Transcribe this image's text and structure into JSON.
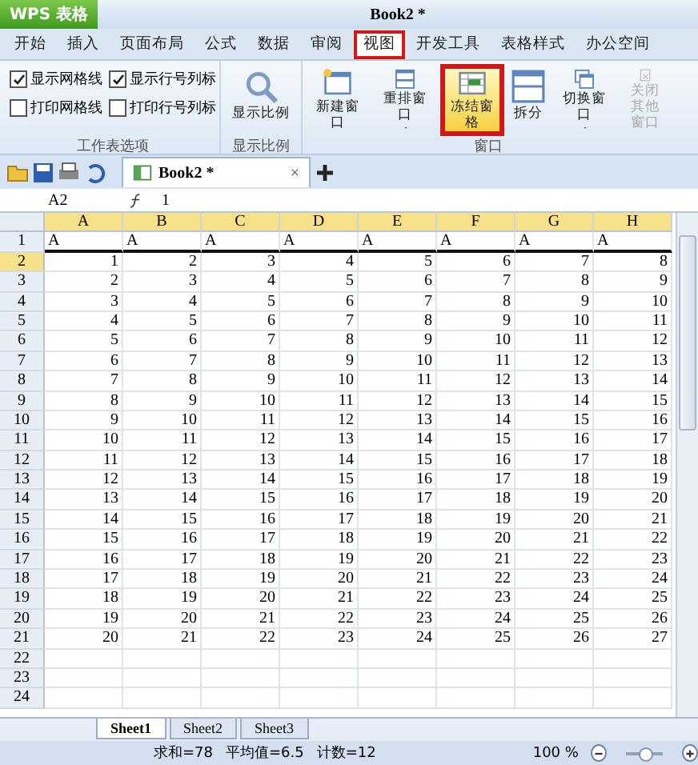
{
  "window": {
    "app_button": "WPS 表格",
    "title": "Book2 *"
  },
  "menu_tabs": [
    {
      "label": "开始",
      "selected": false
    },
    {
      "label": "插入",
      "selected": false
    },
    {
      "label": "页面布局",
      "selected": false
    },
    {
      "label": "公式",
      "selected": false
    },
    {
      "label": "数据",
      "selected": false
    },
    {
      "label": "审阅",
      "selected": false
    },
    {
      "label": "视图",
      "selected": true
    },
    {
      "label": "开发工具",
      "selected": false
    },
    {
      "label": "表格样式",
      "selected": false
    },
    {
      "label": "办公空间",
      "selected": false
    }
  ],
  "ribbon": {
    "sheet_options": {
      "title": "工作表选项",
      "checkboxes": [
        {
          "label": "显示网格线",
          "checked": true
        },
        {
          "label": "显示行号列标",
          "checked": true
        },
        {
          "label": "打印网格线",
          "checked": false
        },
        {
          "label": "打印行号列标",
          "checked": false
        }
      ]
    },
    "zoom_group": {
      "title": "显示比例",
      "button": "显示比例"
    },
    "window_group": {
      "title": "窗口",
      "buttons": [
        {
          "label": "新建窗口",
          "kind": "new",
          "dropdown": false,
          "highlighted": false,
          "disabled": false
        },
        {
          "label": "重排窗口",
          "kind": "arrange",
          "dropdown": true,
          "highlighted": false,
          "disabled": false
        },
        {
          "label": "冻结窗格",
          "kind": "freeze",
          "dropdown": false,
          "highlighted": true,
          "disabled": false
        },
        {
          "label": "拆分",
          "kind": "split",
          "dropdown": false,
          "highlighted": false,
          "disabled": false
        },
        {
          "label": "切换窗口",
          "kind": "switch",
          "dropdown": true,
          "highlighted": false,
          "disabled": false
        },
        {
          "label": "关闭其他窗口",
          "kind": "close",
          "dropdown": false,
          "highlighted": false,
          "disabled": true
        }
      ]
    }
  },
  "doc_tab": {
    "label": "Book2 *",
    "close": "×"
  },
  "formula_bar": {
    "name_box": "A2",
    "value": "1"
  },
  "sheet": {
    "columns": [
      "A",
      "B",
      "C",
      "D",
      "E",
      "F",
      "G",
      "H"
    ],
    "rows": [
      {
        "header": "1",
        "cells": [
          "A",
          "A",
          "A",
          "A",
          "A",
          "A",
          "A",
          "A"
        ]
      },
      {
        "header": "2",
        "cells": [
          "1",
          "2",
          "3",
          "4",
          "5",
          "6",
          "7",
          "8"
        ]
      },
      {
        "header": "3",
        "cells": [
          "2",
          "3",
          "4",
          "5",
          "6",
          "7",
          "8",
          "9"
        ]
      },
      {
        "header": "4",
        "cells": [
          "3",
          "4",
          "5",
          "6",
          "7",
          "8",
          "9",
          "10"
        ]
      },
      {
        "header": "5",
        "cells": [
          "4",
          "5",
          "6",
          "7",
          "8",
          "9",
          "10",
          "11"
        ]
      },
      {
        "header": "6",
        "cells": [
          "5",
          "6",
          "7",
          "8",
          "9",
          "10",
          "11",
          "12"
        ]
      },
      {
        "header": "7",
        "cells": [
          "6",
          "7",
          "8",
          "9",
          "10",
          "11",
          "12",
          "13"
        ]
      },
      {
        "header": "8",
        "cells": [
          "7",
          "8",
          "9",
          "10",
          "11",
          "12",
          "13",
          "14"
        ]
      },
      {
        "header": "9",
        "cells": [
          "8",
          "9",
          "10",
          "11",
          "12",
          "13",
          "14",
          "15"
        ]
      },
      {
        "header": "10",
        "cells": [
          "9",
          "10",
          "11",
          "12",
          "13",
          "14",
          "15",
          "16"
        ]
      },
      {
        "header": "11",
        "cells": [
          "10",
          "11",
          "12",
          "13",
          "14",
          "15",
          "16",
          "17"
        ]
      },
      {
        "header": "12",
        "cells": [
          "11",
          "12",
          "13",
          "14",
          "15",
          "16",
          "17",
          "18"
        ]
      },
      {
        "header": "13",
        "cells": [
          "12",
          "13",
          "14",
          "15",
          "16",
          "17",
          "18",
          "19"
        ]
      },
      {
        "header": "14",
        "cells": [
          "13",
          "14",
          "15",
          "16",
          "17",
          "18",
          "19",
          "20"
        ]
      },
      {
        "header": "15",
        "cells": [
          "14",
          "15",
          "16",
          "17",
          "18",
          "19",
          "20",
          "21"
        ]
      },
      {
        "header": "16",
        "cells": [
          "15",
          "16",
          "17",
          "18",
          "19",
          "20",
          "21",
          "22"
        ]
      },
      {
        "header": "17",
        "cells": [
          "16",
          "17",
          "18",
          "19",
          "20",
          "21",
          "22",
          "23"
        ]
      },
      {
        "header": "18",
        "cells": [
          "17",
          "18",
          "19",
          "20",
          "21",
          "22",
          "23",
          "24"
        ]
      },
      {
        "header": "19",
        "cells": [
          "18",
          "19",
          "20",
          "21",
          "22",
          "23",
          "24",
          "25"
        ]
      },
      {
        "header": "20",
        "cells": [
          "19",
          "20",
          "21",
          "22",
          "23",
          "24",
          "25",
          "26"
        ]
      },
      {
        "header": "21",
        "cells": [
          "20",
          "21",
          "22",
          "23",
          "24",
          "25",
          "26",
          "27"
        ]
      },
      {
        "header": "22",
        "cells": []
      },
      {
        "header": "23",
        "cells": []
      },
      {
        "header": "24",
        "cells": []
      }
    ]
  },
  "sheet_tabs": [
    {
      "label": "Sheet1",
      "selected": true
    },
    {
      "label": "Sheet2",
      "selected": false
    },
    {
      "label": "Sheet3",
      "selected": false
    }
  ],
  "status_bar": {
    "sum": "求和=78",
    "average": "平均值=6.5",
    "count": "计数=12",
    "zoom": "100 %",
    "zoom_level": {
      "level": 0.5
    }
  }
}
